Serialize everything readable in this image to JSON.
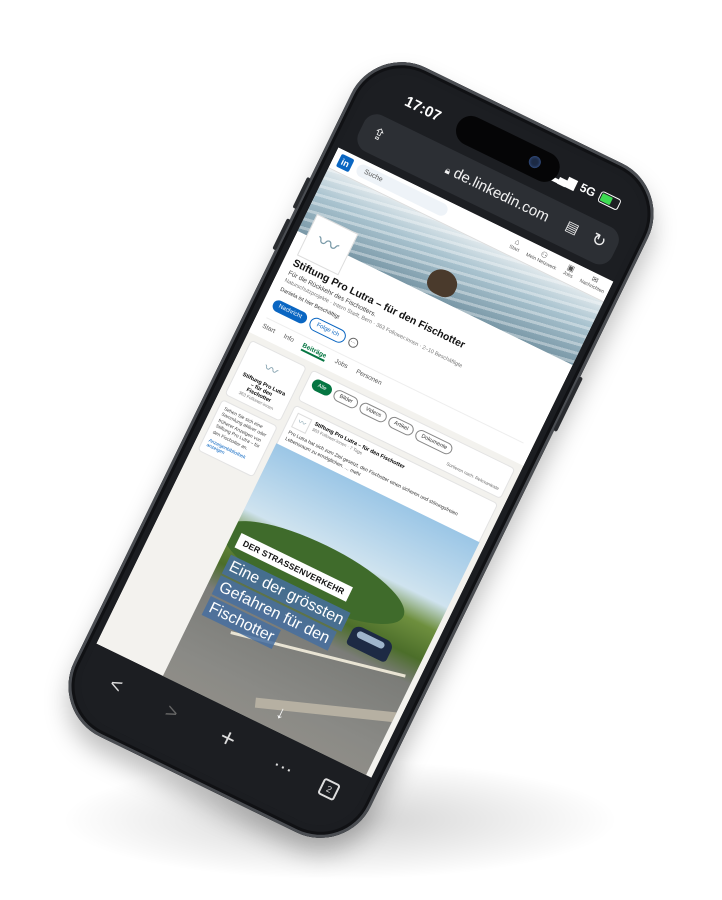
{
  "status": {
    "time": "17:07",
    "network": "5G"
  },
  "browser": {
    "url": "de.linkedin.com"
  },
  "linkedin": {
    "search_placeholder": "Suche",
    "nav": [
      "Start",
      "Mein Netzwerk",
      "Jobs",
      "Nachrichten",
      "Mitteilungen"
    ],
    "company": {
      "name": "Stiftung Pro Lutra – für den Fischotter",
      "tagline": "Für die Rückkehr des Fischotters.",
      "meta": "Naturschutzprojekte · Intern Stadt, Bern · 363 Follower:innen · 2–10 Beschäftigte",
      "follow_note": "Daniela ist hier Beschäftigt",
      "message_btn": "Nachricht",
      "following_btn": "Folge ich",
      "more_btn": "…",
      "tabs": [
        "Start",
        "Info",
        "Beiträge",
        "Jobs",
        "Personen"
      ],
      "active_tab": "Beiträge"
    },
    "sidebar": {
      "name": "Stiftung Pro Lutra – für den Fischotter",
      "followers": "363 Follower:innen",
      "text": "Sehen Sie sich eine Sammlung aktiver oder früherer Anzeigen von Stiftung Pro Lutra – für den Fischotter an.",
      "link": "Anzeigenbibliothek anzeigen"
    },
    "filters": [
      "Alle",
      "Bilder",
      "Videos",
      "Artikel",
      "Dokumente"
    ],
    "sort": "Sortieren nach: Relevanteste",
    "post": {
      "author": "Stiftung Pro Lutra – für den Fischotter",
      "meta": "363 Follower:innen · 7 Tage",
      "text": "Pro Lutra hat sich zum Ziel gesetzt, den Fischotter einen sicheren und störungsfreien Lebensraum zu ermöglichen. … mehr",
      "image_label": "DER STRASSENVERKEHR",
      "headline": [
        "Eine der grössten",
        "Gefahren für den",
        "Fischotter"
      ]
    }
  },
  "toolbar": {
    "back": "<",
    "forward": ">",
    "new_tab": "+",
    "more": "···"
  }
}
